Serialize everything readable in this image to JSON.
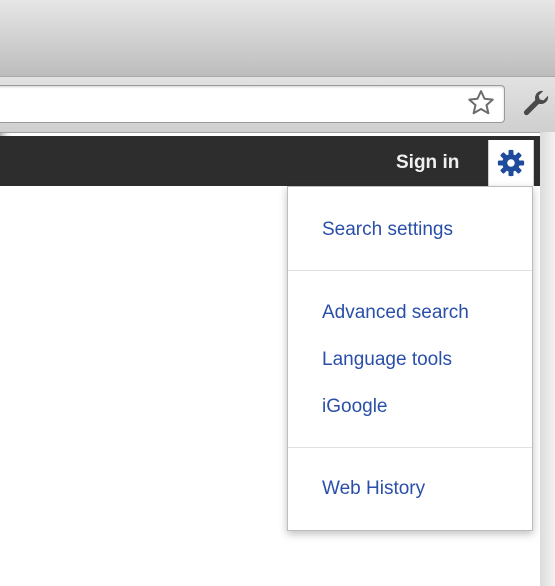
{
  "header": {
    "sign_in_label": "Sign in"
  },
  "icons": {
    "bookmark": "star-icon",
    "settings_wrench": "wrench-icon",
    "options_gear": "gear-icon"
  },
  "menu": {
    "items": [
      {
        "label": "Search settings"
      },
      {
        "label": "Advanced search"
      },
      {
        "label": "Language tools"
      },
      {
        "label": "iGoogle"
      },
      {
        "label": "Web History"
      }
    ]
  },
  "colors": {
    "link_blue": "#2a4fa8",
    "bar_dark": "#2d2d2d",
    "gear_blue": "#1f4b9c"
  }
}
